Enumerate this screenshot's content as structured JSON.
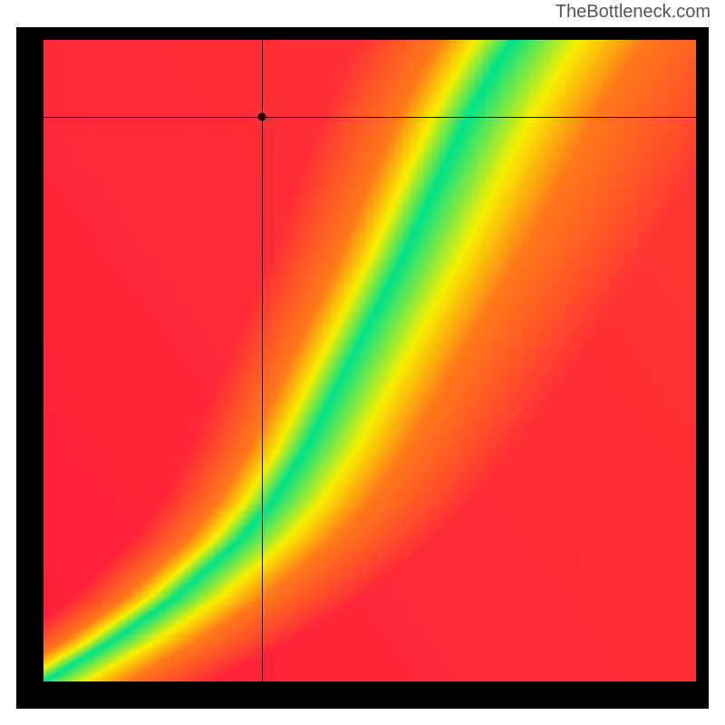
{
  "attribution": "TheBottleneck.com",
  "chart_data": {
    "type": "heatmap",
    "title": "",
    "xlabel": "",
    "ylabel": "",
    "xlim": [
      0,
      1
    ],
    "ylim": [
      0,
      1
    ],
    "crosshair": {
      "x": 0.335,
      "y": 0.88
    },
    "ridge": {
      "description": "Green optimal band along a curve from bottom-left to upper-center-right; colors grade green→yellow→orange→red with distance from the ridge.",
      "points_xy": [
        [
          0.0,
          0.0
        ],
        [
          0.1,
          0.06
        ],
        [
          0.2,
          0.13
        ],
        [
          0.3,
          0.22
        ],
        [
          0.35,
          0.28
        ],
        [
          0.4,
          0.36
        ],
        [
          0.45,
          0.46
        ],
        [
          0.5,
          0.56
        ],
        [
          0.55,
          0.66
        ],
        [
          0.6,
          0.77
        ],
        [
          0.65,
          0.88
        ],
        [
          0.7,
          0.97
        ],
        [
          0.72,
          1.0
        ]
      ],
      "band_halfwidth_x": 0.035
    },
    "palette": {
      "green": "#00E28A",
      "yellow": "#F8F000",
      "orange": "#FF7A1A",
      "red": "#FF1E3C"
    },
    "background_bias": {
      "description": "Far from ridge, left side tends red, right side tends orange/yellow; gradient is smooth.",
      "top_right_hue_shift": 0.25
    }
  }
}
